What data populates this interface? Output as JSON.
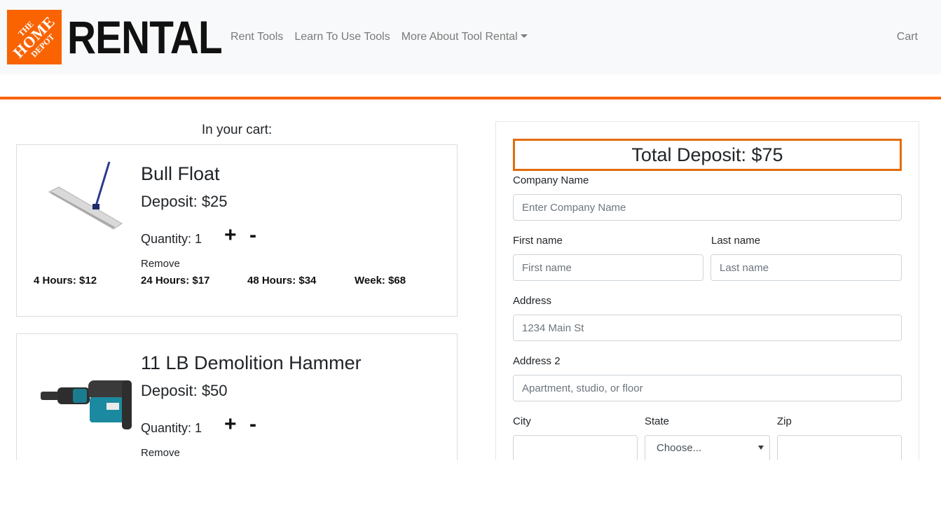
{
  "brand": {
    "logo_text_small_top": "THE",
    "logo_text_big": "HOME",
    "logo_text_mid": "DEPOT",
    "wordmark": "RENTAL"
  },
  "nav": {
    "links": [
      {
        "label": "Rent Tools"
      },
      {
        "label": "Learn To Use Tools"
      },
      {
        "label": "More About Tool Rental",
        "icon": "caret-down-icon"
      }
    ],
    "cart_label": "Cart"
  },
  "colors": {
    "accent": "#f96302",
    "total_border": "#e36c0a",
    "navbar_bg": "#f8f9fa"
  },
  "cart": {
    "heading": "In your cart:",
    "items": [
      {
        "name": "Bull Float",
        "deposit": "Deposit: $25",
        "quantity": "Quantity: 1",
        "plus": "+",
        "minus": "-",
        "remove": "Remove",
        "prices": [
          "4 Hours: $12",
          "24 Hours: $17",
          "48 Hours: $34",
          "Week: $68"
        ]
      },
      {
        "name": "11 LB Demolition Hammer",
        "deposit": "Deposit: $50",
        "quantity": "Quantity: 1",
        "plus": "+",
        "minus": "-",
        "remove": "Remove"
      }
    ]
  },
  "form": {
    "total": "Total Deposit: $75",
    "company": {
      "label": "Company Name",
      "placeholder": "Enter Company Name"
    },
    "first_name": {
      "label": "First name",
      "placeholder": "First name"
    },
    "last_name": {
      "label": "Last name",
      "placeholder": "Last name"
    },
    "address": {
      "label": "Address",
      "placeholder": "1234 Main St"
    },
    "address2": {
      "label": "Address 2",
      "placeholder": "Apartment, studio, or floor"
    },
    "city": {
      "label": "City",
      "placeholder": ""
    },
    "state": {
      "label": "State",
      "selected": "Choose..."
    },
    "zip": {
      "label": "Zip",
      "placeholder": ""
    }
  }
}
